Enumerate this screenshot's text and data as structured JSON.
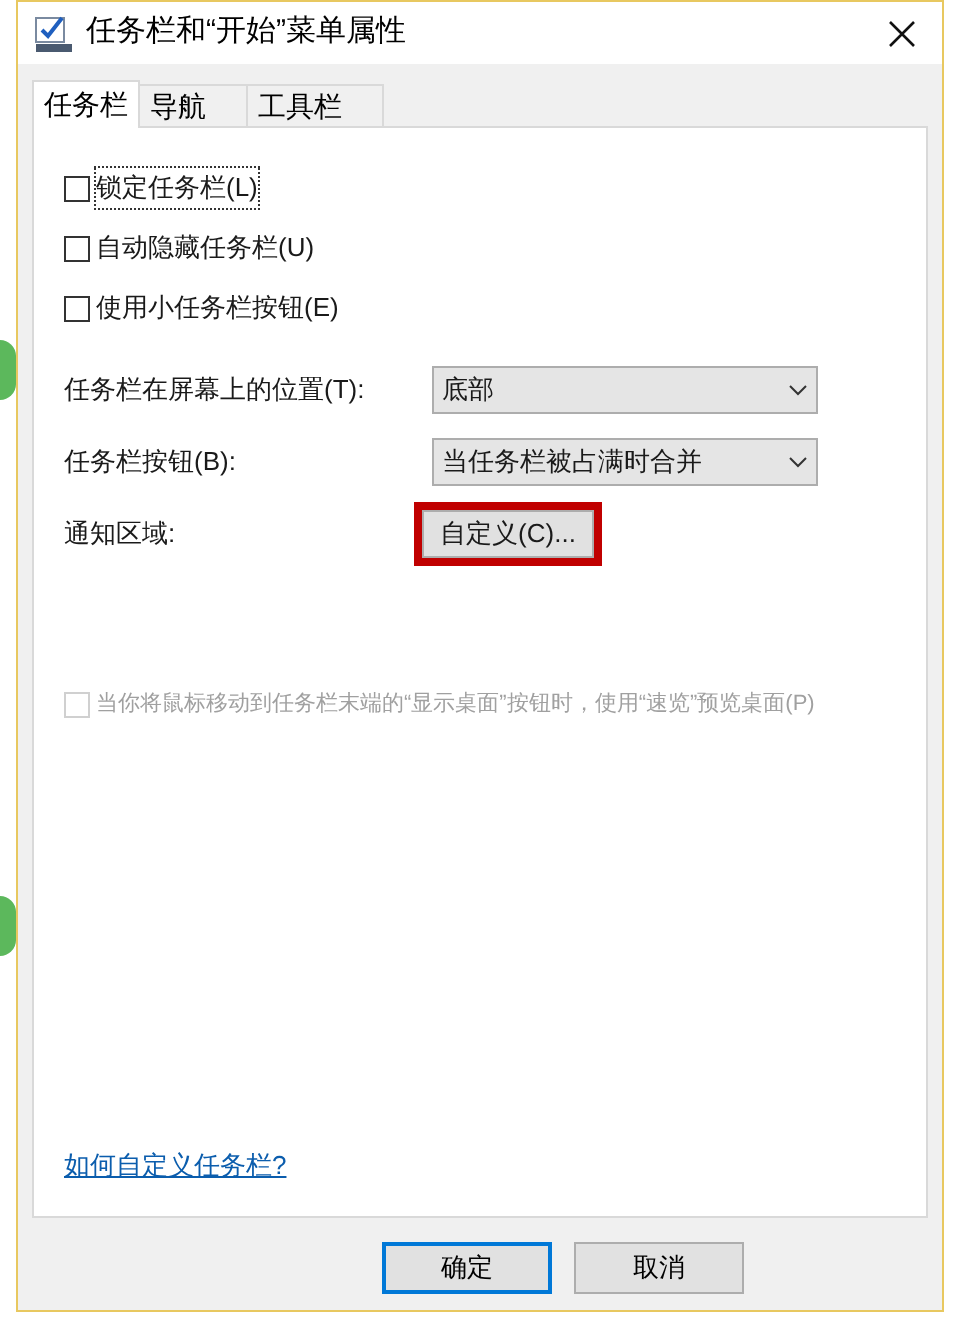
{
  "window": {
    "title": "任务栏和“开始”菜单属性"
  },
  "tabs": [
    {
      "label": "任务栏",
      "selected": true
    },
    {
      "label": "导航",
      "selected": false
    },
    {
      "label": "工具栏",
      "selected": false
    }
  ],
  "checkboxes": [
    {
      "label": "锁定任务栏(L)",
      "checked": false,
      "disabled": false,
      "focused": true
    },
    {
      "label": "自动隐藏任务栏(U)",
      "checked": false,
      "disabled": false,
      "focused": false
    },
    {
      "label": "使用小任务栏按钮(E)",
      "checked": false,
      "disabled": false,
      "focused": false
    }
  ],
  "settings": [
    {
      "kind": "dropdown",
      "label": "任务栏在屏幕上的位置(T):",
      "value": "底部"
    },
    {
      "kind": "dropdown",
      "label": "任务栏按钮(B):",
      "value": "当任务栏被占满时合并"
    },
    {
      "kind": "button",
      "label": "通知区域:",
      "value": "自定义(C)...",
      "highlighted": true
    }
  ],
  "peek_option": {
    "label": "当你将鼠标移动到任务栏末端的“显示桌面”按钮时，使用“速览”预览桌面(P)",
    "checked": false,
    "disabled": true
  },
  "help_link": "如何自定义任务栏?",
  "buttons": [
    {
      "label": "确定",
      "default": true
    },
    {
      "label": "取消",
      "default": false
    }
  ]
}
